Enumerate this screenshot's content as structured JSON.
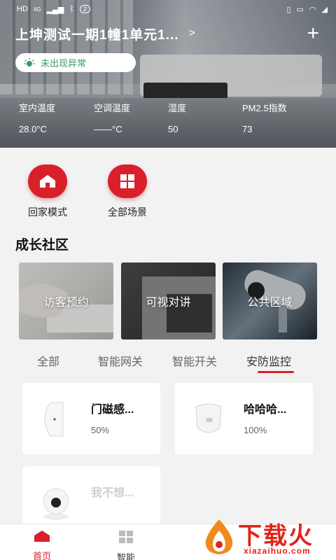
{
  "status_bar": {
    "left_text": "HD",
    "signal_badge": "4G",
    "battery_pill": "2"
  },
  "header": {
    "home_name": "上坤测试一期1幢1单元1...",
    "alarm_status": "未出现异常",
    "env": [
      {
        "label": "室内温度",
        "value": "28.0°C"
      },
      {
        "label": "空调温度",
        "value": "——°C"
      },
      {
        "label": "湿度",
        "value": "50"
      },
      {
        "label": "PM2.5指数",
        "value": "73"
      }
    ]
  },
  "quick_actions": [
    {
      "label": "回家模式",
      "icon": "home-icon"
    },
    {
      "label": "全部场景",
      "icon": "grid-icon"
    }
  ],
  "community": {
    "title": "成长社区",
    "cards": [
      {
        "label": "访客预约"
      },
      {
        "label": "可视对讲"
      },
      {
        "label": "公共区域"
      }
    ]
  },
  "tabs": [
    {
      "label": "全部"
    },
    {
      "label": "智能网关"
    },
    {
      "label": "智能开关"
    },
    {
      "label": "安防监控",
      "active": true
    }
  ],
  "devices": [
    {
      "name": "门磁感...",
      "value": "50%",
      "icon": "door-sensor-icon"
    },
    {
      "name": "哈哈哈...",
      "value": "100%",
      "icon": "motion-sensor-icon"
    },
    {
      "name": "我不想...",
      "value": "",
      "icon": "camera-icon"
    }
  ],
  "bottom_nav": [
    {
      "label": "首页",
      "active": true
    },
    {
      "label": "智能",
      "active": false
    }
  ],
  "watermark": {
    "big": "下载火",
    "small": "xiazaihuo.com"
  },
  "colors": {
    "accent": "#d9202a",
    "alarm_ok": "#3b9a6c"
  }
}
